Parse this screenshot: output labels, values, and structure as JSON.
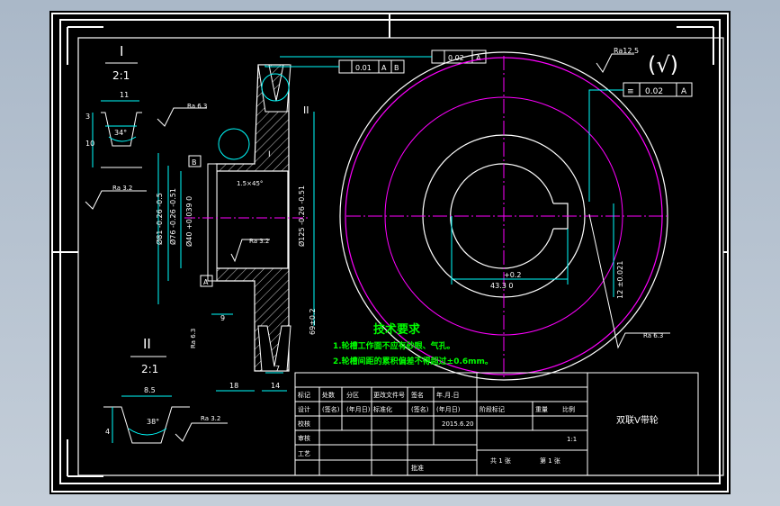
{
  "colors": {
    "background": "#000000",
    "frame": "#ffffff",
    "dimension": "#00ffff",
    "outline": "#ffffff",
    "centerline": "#ff00ff",
    "notes": "#00ff00",
    "viewport": "#aab8c8"
  },
  "detail_1": {
    "label": "I",
    "scale": "2:1",
    "dim_top": "11",
    "dim_left_a": "3",
    "dim_left_b": "10",
    "angle": "34°",
    "roughness": "Ra 6.3",
    "roughness_b": "Ra 3.2"
  },
  "detail_2": {
    "label": "II",
    "scale": "2:1",
    "dim_top": "8.5",
    "dim_left": "4",
    "angle": "38°",
    "roughness": "Ra 3.2"
  },
  "section": {
    "tol_1": "0.01",
    "datum_1a": "A",
    "datum_1b": "B",
    "tol_2": "0.02",
    "datum_2": "A",
    "label_I": "I",
    "label_II": "II",
    "datum_B": "B",
    "datum_A": "A",
    "chamfer": "1.5×45°",
    "dia_81": "Ø81 -0.26 -0.5",
    "dia_76": "Ø76 -0.26 -0.51",
    "dia_40": "Ø40 +0.039 0",
    "dia_125": "Ø125 -0.26 -0.51",
    "dim_9": "9",
    "dim_18": "18",
    "dim_14": "14",
    "dim_7": "7",
    "dim_vert": "69±0.2",
    "roughness_a": "Ra 3.2",
    "roughness_b": "Ra 6.3"
  },
  "front_view": {
    "dim_keyway": "43.3 0",
    "dim_keyway_tol": "+0.2",
    "dim_key_width": "12 ±0.021",
    "roughness": "Ra 6.3",
    "flatness": "0.02",
    "flat_datum": "A"
  },
  "surface": {
    "general": "Ra12.5",
    "rest": "(√)"
  },
  "notes": {
    "title": "技术要求",
    "line1": "1.轮槽工作面不应有砂眼、气孔。",
    "line2": "2.轮槽间距的累积偏差不得超过±0.6mm。"
  },
  "title_block": {
    "r1": [
      "标记",
      "处数",
      "分区",
      "更改文件号",
      "签名",
      "年.月.日"
    ],
    "r2": [
      "设计",
      "(签名)",
      "(年月日)",
      "标准化",
      "(签名)",
      "(年月日)"
    ],
    "stage_headers": [
      "阶段标记",
      "重量",
      "比例"
    ],
    "r3": [
      "校核",
      "",
      "",
      "",
      "",
      "2015.6.20"
    ],
    "r4": [
      "审核"
    ],
    "r5": [
      "工艺",
      "批准"
    ],
    "scale": "1:1",
    "sheets": "共 1 张",
    "sheet_no": "第 1 张",
    "drawing_name": "双联V带轮"
  }
}
